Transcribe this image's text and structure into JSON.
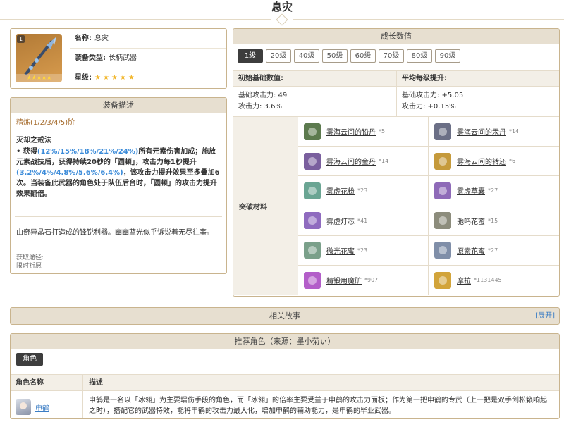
{
  "page": {
    "title": "息灾"
  },
  "info": {
    "badge": "1",
    "name_label": "名称:",
    "name": "息灾",
    "type_label": "装备类型:",
    "type": "长柄武器",
    "rarity_label": "星级:",
    "rarity_stars": "★★★★★",
    "rarity": 5
  },
  "description": {
    "title": "装备描述",
    "refine": "精炼(1/2/3/4/5)阶",
    "passive_name": "灭却之戒法",
    "passive_p1": "• 获得",
    "passive_v1": "(12%/15%/18%/21%/24%)",
    "passive_p2": "所有元素伤害加成；施放元素战技后，获得持续20秒的「圆顿」，攻击力每1秒提升",
    "passive_v2": "(3.2%/4%/4.8%/5.6%/6.4%)",
    "passive_p3": "，该攻击力提升效果至多叠加6次。当装备此武器的角色处于队伍后台时，「圆顿」的攻击力提升效果翻倍。",
    "flavor": "由奇异晶石打造成的锋锐利器。幽幽蓝光似乎诉说着无尽往事。",
    "source_label": "获取途径:",
    "source": "限时祈愿"
  },
  "growth": {
    "title": "成长数值",
    "levels": [
      "1级",
      "20级",
      "40级",
      "50级",
      "60级",
      "70级",
      "80级",
      "90级"
    ],
    "active_level": "1级",
    "base_head": "初始基础数值:",
    "base_lines": [
      "基础攻击力: 49",
      "攻击力: 3.6%"
    ],
    "avg_head": "平均每级提升:",
    "avg_lines": [
      "基础攻击力: +5.05",
      "攻击力: +0.15%"
    ],
    "materials_label": "突破材料",
    "materials": [
      {
        "name": "雾海云间的铅丹",
        "count": "*5",
        "color": "#5c7a4e"
      },
      {
        "name": "雾海云间的汞丹",
        "count": "*14",
        "color": "#6b6f86"
      },
      {
        "name": "雾海云间的金丹",
        "count": "*14",
        "color": "#7a5f9e"
      },
      {
        "name": "雾海云间的转还",
        "count": "*6",
        "color": "#c59a3b"
      },
      {
        "name": "雾虚花粉",
        "count": "*23",
        "color": "#6aa593"
      },
      {
        "name": "雾虚草囊",
        "count": "*27",
        "color": "#8e6ab8"
      },
      {
        "name": "雾虚灯芯",
        "count": "*41",
        "color": "#8f6bbf"
      },
      {
        "name": "驰鸣花蜜",
        "count": "*15",
        "color": "#8c8c7c"
      },
      {
        "name": "微光花蜜",
        "count": "*23",
        "color": "#7aa08a"
      },
      {
        "name": "原素花蜜",
        "count": "*27",
        "color": "#7f8ea8"
      },
      {
        "name": "精锻用魔矿",
        "count": "*907",
        "color": "#b35ec9"
      },
      {
        "name": "摩拉",
        "count": "*1131445",
        "color": "#d2a43a"
      }
    ]
  },
  "story": {
    "title": "相关故事",
    "expand": "[展开]"
  },
  "recommend": {
    "title": "推荐角色（来源：墨小菊ぃ）",
    "tab": "角色",
    "col_name": "角色名称",
    "col_desc": "描述",
    "character": "申鹤",
    "desc": "申鹤是一名以「冰翎」为主要增伤手段的角色，而「冰翎」的倍率主要受益于申鹤的攻击力面板；作为第一把申鹤的专武（上一把是双手剑松籁响起之时），搭配它的武器特效，能将申鹤的攻击力最大化，增加申鹤的辅助能力，是申鹤的毕业武器。"
  }
}
